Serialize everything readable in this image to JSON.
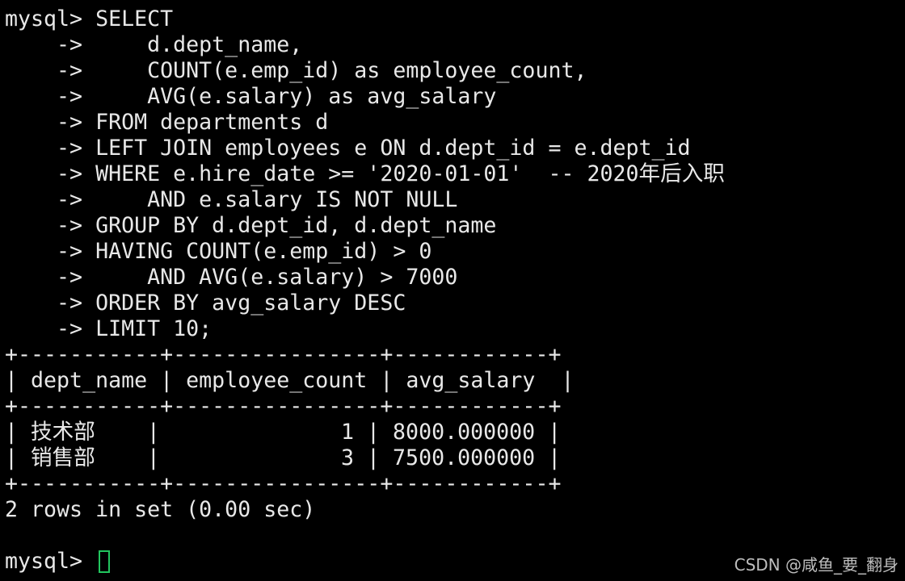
{
  "terminal": {
    "query_lines": [
      "mysql> SELECT",
      "    ->     d.dept_name,",
      "    ->     COUNT(e.emp_id) as employee_count,",
      "    ->     AVG(e.salary) as avg_salary",
      "    -> FROM departments d",
      "    -> LEFT JOIN employees e ON d.dept_id = e.dept_id",
      "    -> WHERE e.hire_date >= '2020-01-01'  -- 2020年后入职",
      "    ->     AND e.salary IS NOT NULL",
      "    -> GROUP BY d.dept_id, d.dept_name",
      "    -> HAVING COUNT(e.emp_id) > 0",
      "    ->     AND AVG(e.salary) > 7000",
      "    -> ORDER BY avg_salary DESC",
      "    -> LIMIT 10;"
    ],
    "table": {
      "border": "+-----------+----------------+------------+",
      "header_row": "| dept_name | employee_count | avg_salary  |",
      "rows": [
        "| 技术部    |              1 | 8000.000000 |",
        "| 销售部    |              3 | 7500.000000 |"
      ]
    },
    "result_summary": "2 rows in set (0.00 sec)",
    "prompt": "mysql> ",
    "cursor_color": "#22c55e",
    "text_color": "#e8e8e8",
    "background_color": "#000000"
  },
  "watermark": {
    "text": "CSDN @咸鱼_要_翻身"
  }
}
